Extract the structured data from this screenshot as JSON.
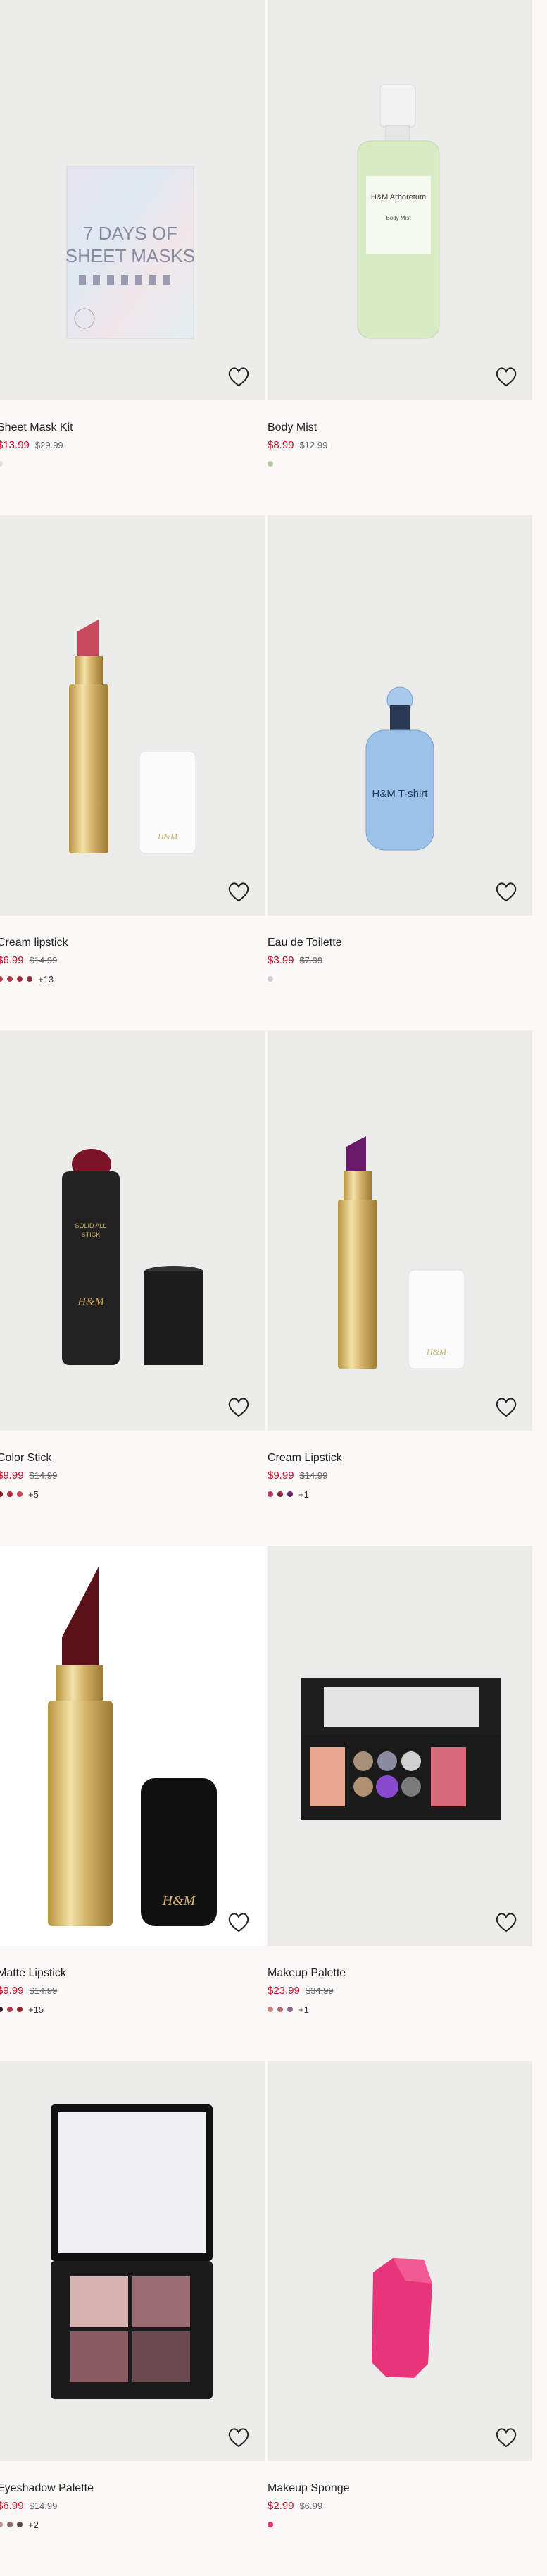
{
  "products": [
    {
      "name": "Sheet Mask Kit",
      "price": "$13.99",
      "original_price": "$29.99",
      "swatches": [
        "#e2ddd6"
      ],
      "more": "",
      "image": "sheet-mask-box"
    },
    {
      "name": "Body Mist",
      "price": "$8.99",
      "original_price": "$12.99",
      "swatches": [
        "#b7c8a0"
      ],
      "more": "",
      "image": "body-mist-bottle"
    },
    {
      "name": "Cream lipstick",
      "price": "$6.99",
      "original_price": "$14.99",
      "swatches": [
        "#c0485a",
        "#b23a4a",
        "#a32f40",
        "#8e2636"
      ],
      "more": "+13",
      "image": "cream-lipstick-red"
    },
    {
      "name": "Eau de Toilette",
      "price": "$3.99",
      "original_price": "$7.99",
      "swatches": [
        "#d8c7d6"
      ],
      "more": "",
      "image": "blue-perfume-bottle"
    },
    {
      "name": "Color Stick",
      "price": "$9.99",
      "original_price": "$14.99",
      "swatches": [
        "#7a1c2a",
        "#b02a3c",
        "#c84a5a"
      ],
      "more": "+5",
      "image": "color-stick"
    },
    {
      "name": "Cream Lipstick",
      "price": "$9.99",
      "original_price": "$14.99",
      "swatches": [
        "#b03a5a",
        "#8a2a3a",
        "#6a2b6a"
      ],
      "more": "+1",
      "image": "cream-lipstick-purple"
    },
    {
      "name": "Matte Lipstick",
      "price": "$9.99",
      "original_price": "$14.99",
      "swatches": [
        "#2a1a1a",
        "#b03a4a",
        "#8a2530"
      ],
      "more": "+15",
      "image": "matte-lipstick"
    },
    {
      "name": "Makeup Palette",
      "price": "$23.99",
      "original_price": "$34.99",
      "swatches": [
        "#c98080",
        "#b06a70",
        "#8a6a8a"
      ],
      "more": "+1",
      "image": "makeup-palette"
    },
    {
      "name": "Eyeshadow Palette",
      "price": "$6.99",
      "original_price": "$14.99",
      "swatches": [
        "#b89a9a",
        "#8a6a6a",
        "#5a4a4a"
      ],
      "more": "+2",
      "image": "eyeshadow-palette"
    },
    {
      "name": "Makeup Sponge",
      "price": "$2.99",
      "original_price": "$6.99",
      "swatches": [
        "#e0387a"
      ],
      "more": "",
      "image": "pink-sponge"
    }
  ],
  "labels": {
    "mask_box": [
      "7 DAYS OF",
      "SHEET MASKS"
    ],
    "mist_brand": "H&M Arboretum",
    "mist_sub": "Body Mist",
    "perfume_brand": "H&M T-shirt",
    "stick_text": [
      "SOLID ALL",
      "STICK"
    ],
    "hm": "H&M"
  }
}
